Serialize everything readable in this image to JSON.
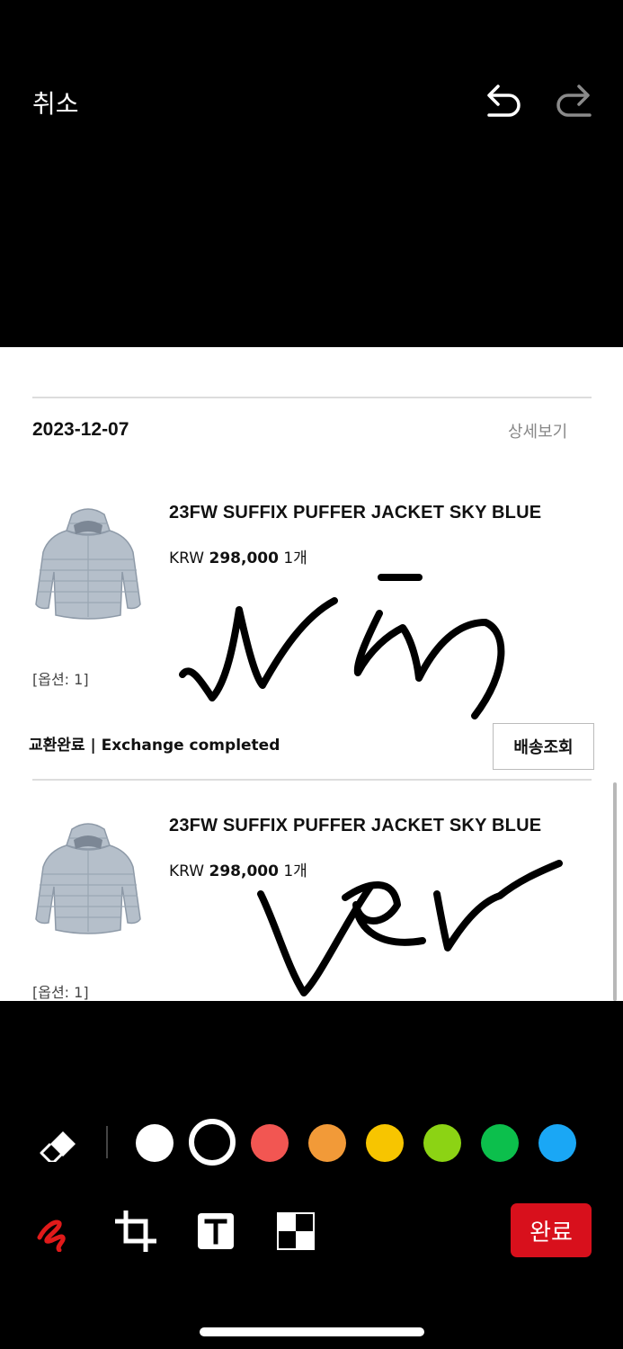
{
  "header": {
    "cancel_label": "취소",
    "undo_icon": "undo-icon",
    "redo_icon": "redo-icon"
  },
  "order": {
    "date": "2023-12-07",
    "detail_link": "상세보기",
    "items": [
      {
        "title": "23FW SUFFIX PUFFER JACKET SKY BLUE",
        "currency": "KRW",
        "amount": "298,000",
        "quantity": "1개",
        "option": "[옵션: 1]",
        "image_icon": "puffer-jacket-image",
        "status": "교환완료 | Exchange completed",
        "track_button": "배송조회"
      },
      {
        "title": "23FW SUFFIX PUFFER JACKET SKY BLUE",
        "currency": "KRW",
        "amount": "298,000",
        "quantity": "1개",
        "option": "[옵션: 1]",
        "image_icon": "puffer-jacket-image"
      }
    ]
  },
  "palette": {
    "eraser_icon": "eraser-icon",
    "colors": [
      {
        "name": "white",
        "hex": "#ffffff",
        "selected": false
      },
      {
        "name": "black",
        "hex": "#000000",
        "selected": true
      },
      {
        "name": "red",
        "hex": "#f25652",
        "selected": false
      },
      {
        "name": "orange",
        "hex": "#f29a38",
        "selected": false
      },
      {
        "name": "yellow",
        "hex": "#f7c500",
        "selected": false
      },
      {
        "name": "green-yellow",
        "hex": "#8cd314",
        "selected": false
      },
      {
        "name": "green",
        "hex": "#0cbf4c",
        "selected": false
      },
      {
        "name": "blue",
        "hex": "#1aa7f5",
        "selected": false
      }
    ]
  },
  "tools": {
    "pen_icon": "pen-scribble-icon",
    "crop_icon": "crop-icon",
    "text_icon": "text-icon",
    "mosaic_icon": "mosaic-icon",
    "done_label": "완료",
    "done_color": "#d8101c"
  }
}
